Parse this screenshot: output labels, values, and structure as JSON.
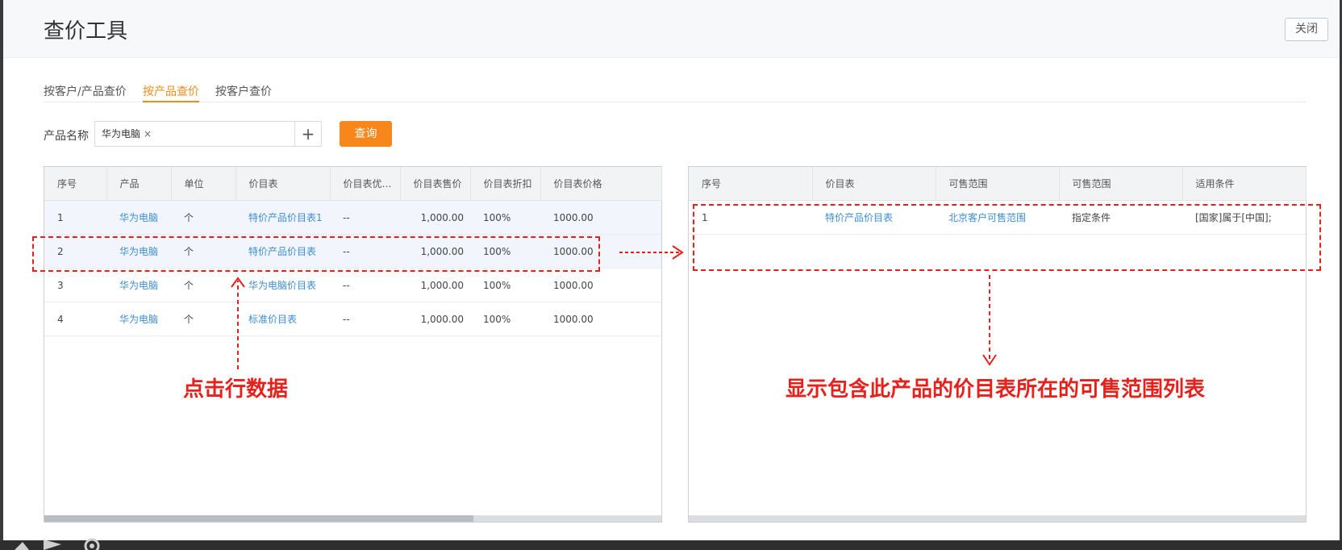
{
  "header": {
    "title": "查价工具",
    "close_label": "关闭"
  },
  "tabs": [
    {
      "label": "按客户/产品查价",
      "active": false
    },
    {
      "label": "按产品查价",
      "active": true
    },
    {
      "label": "按客户查价",
      "active": false
    }
  ],
  "filter": {
    "label": "产品名称",
    "tag": "华为电脑",
    "tag_remove": "×",
    "add_icon": "+",
    "query_label": "查询"
  },
  "left_table": {
    "columns": [
      "序号",
      "产品",
      "单位",
      "价目表",
      "价目表优先...",
      "价目表售价",
      "价目表折扣",
      "价目表价格"
    ],
    "rows": [
      {
        "seq": "1",
        "product": "华为电脑",
        "unit": "个",
        "price_list": "特价产品价目表1",
        "priority": "--",
        "sale_price": "1,000.00",
        "discount": "100%",
        "price": "1000.00"
      },
      {
        "seq": "2",
        "product": "华为电脑",
        "unit": "个",
        "price_list": "特价产品价目表",
        "priority": "--",
        "sale_price": "1,000.00",
        "discount": "100%",
        "price": "1000.00"
      },
      {
        "seq": "3",
        "product": "华为电脑",
        "unit": "个",
        "price_list": "华为电脑价目表",
        "priority": "--",
        "sale_price": "1,000.00",
        "discount": "100%",
        "price": "1000.00"
      },
      {
        "seq": "4",
        "product": "华为电脑",
        "unit": "个",
        "price_list": "标准价目表",
        "priority": "--",
        "sale_price": "1,000.00",
        "discount": "100%",
        "price": "1000.00"
      }
    ]
  },
  "right_table": {
    "columns": [
      "序号",
      "价目表",
      "可售范围",
      "可售范围",
      "适用条件"
    ],
    "rows": [
      {
        "seq": "1",
        "price_list": "特价产品价目表",
        "scope_name": "北京客户可售范围",
        "scope_type": "指定条件",
        "condition": "[国家]属于[中国];"
      }
    ]
  },
  "annotations": {
    "click_hint": "点击行数据",
    "result_hint": "显示包含此产品的价目表所在的可售范围列表",
    "color": "#e8201c"
  },
  "colors": {
    "accent": "#f08c1a",
    "button": "#f7871a",
    "link": "#3c8dd4"
  }
}
